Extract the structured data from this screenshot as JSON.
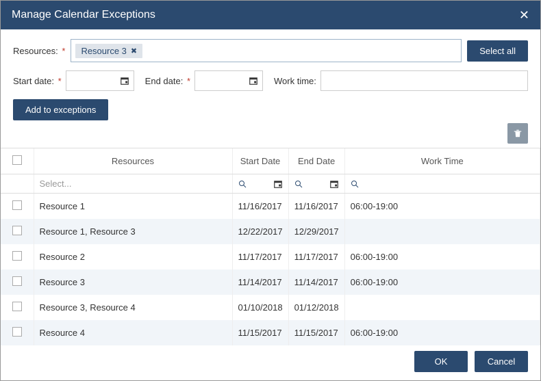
{
  "dialog": {
    "title": "Manage Calendar Exceptions"
  },
  "form": {
    "resources_label": "Resources:",
    "selected_tag": "Resource 3",
    "select_all": "Select all",
    "start_date_label": "Start date:",
    "end_date_label": "End date:",
    "work_time_label": "Work time:",
    "add_btn": "Add to exceptions"
  },
  "grid": {
    "columns": {
      "resources": "Resources",
      "start": "Start Date",
      "end": "End Date",
      "work": "Work Time"
    },
    "filter_placeholder": "Select...",
    "rows": [
      {
        "resources": "Resource 1",
        "start": "11/16/2017",
        "end": "11/16/2017",
        "work": "06:00-19:00"
      },
      {
        "resources": "Resource 1, Resource 3",
        "start": "12/22/2017",
        "end": "12/29/2017",
        "work": ""
      },
      {
        "resources": "Resource 2",
        "start": "11/17/2017",
        "end": "11/17/2017",
        "work": "06:00-19:00"
      },
      {
        "resources": "Resource 3",
        "start": "11/14/2017",
        "end": "11/14/2017",
        "work": "06:00-19:00"
      },
      {
        "resources": "Resource 3, Resource 4",
        "start": "01/10/2018",
        "end": "01/12/2018",
        "work": ""
      },
      {
        "resources": "Resource 4",
        "start": "11/15/2017",
        "end": "11/15/2017",
        "work": "06:00-19:00"
      }
    ]
  },
  "footer": {
    "ok": "OK",
    "cancel": "Cancel"
  }
}
